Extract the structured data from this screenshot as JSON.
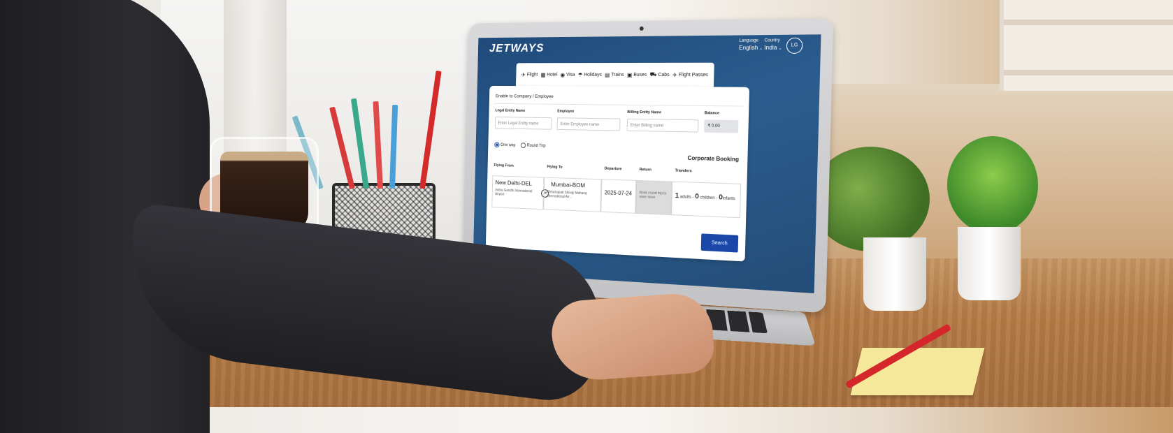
{
  "header": {
    "logo": "JETWAYS",
    "language_label": "Language",
    "language_value": "English",
    "country_label": "Country",
    "country_value": "India",
    "avatar_initials": "LG"
  },
  "tabs": [
    {
      "label": "Flight",
      "icon": "plane-icon"
    },
    {
      "label": "Hotel",
      "icon": "hotel-icon"
    },
    {
      "label": "Visa",
      "icon": "visa-icon"
    },
    {
      "label": "Holidays",
      "icon": "holidays-icon"
    },
    {
      "label": "Trains",
      "icon": "train-icon"
    },
    {
      "label": "Buses",
      "icon": "bus-icon"
    },
    {
      "label": "Cabs",
      "icon": "cab-icon"
    },
    {
      "label": "Flight Passes",
      "icon": "flight-pass-icon"
    }
  ],
  "booking": {
    "section_title": "Enable to Company / Employee",
    "legal_entity_label": "Legal Entity Name",
    "legal_entity_placeholder": "Enter Legal Entity name",
    "employee_label": "Employee",
    "employee_placeholder": "Enter Employee name",
    "billing_label": "Billing Entity Name",
    "billing_placeholder": "Enter Billing name",
    "balance_label": "Balance",
    "balance_value": "₹ 0.00",
    "trip_types": [
      "One way",
      "Round Trip"
    ],
    "selected_trip": "One way",
    "corporate_label": "Corporate Booking",
    "flying_from_label": "Flying From",
    "flying_from_city": "New Delhi-DEL",
    "flying_from_airport": "Indira Gandhi International Airport",
    "flying_to_label": "Flying To",
    "flying_to_city": "Mumbai-BOM",
    "flying_to_airport": "Chhatrapati Shivaji Maharaj International Air...",
    "departure_label": "Departure",
    "departure_value": "2025-07-24",
    "return_label": "Return",
    "return_text": "Book round trip to save more",
    "travelers_label": "Travelers",
    "adults_count": "1",
    "adults_label": "adults -",
    "children_count": "0",
    "children_label": "children -",
    "infants_count": "0",
    "infants_label": "infants",
    "search_label": "Search"
  },
  "colors": {
    "brand_blue": "#1b47a8",
    "hero_bg": "#244d78"
  }
}
